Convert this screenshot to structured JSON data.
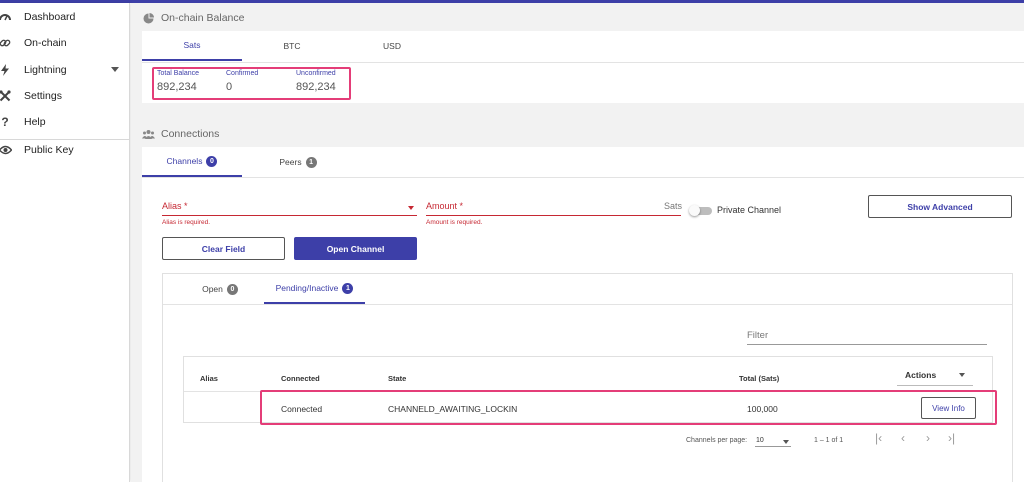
{
  "sidebar": {
    "items": [
      {
        "label": "Dashboard",
        "icon": "dashboard-icon"
      },
      {
        "label": "On-chain",
        "icon": "link-icon"
      },
      {
        "label": "Lightning",
        "icon": "lightning-icon"
      },
      {
        "label": "Settings",
        "icon": "settings-icon"
      },
      {
        "label": "Help",
        "icon": "help-icon"
      },
      {
        "label": "Public Key",
        "icon": "eye-icon"
      }
    ]
  },
  "balance": {
    "title": "On-chain Balance",
    "tabs": [
      "Sats",
      "BTC",
      "USD"
    ],
    "active_tab": "Sats",
    "total_label": "Total Balance",
    "total_value": "892,234",
    "confirmed_label": "Confirmed",
    "confirmed_value": "0",
    "unconfirmed_label": "Unconfirmed",
    "unconfirmed_value": "892,234"
  },
  "connections": {
    "title": "Connections",
    "tabs": [
      {
        "label": "Channels",
        "count": "0"
      },
      {
        "label": "Peers",
        "count": "1"
      }
    ],
    "form": {
      "alias_label": "Alias *",
      "alias_error": "Alias is required.",
      "amount_label": "Amount *",
      "amount_error": "Amount is required.",
      "amount_suffix": "Sats",
      "private_channel_label": "Private Channel",
      "show_advanced": "Show Advanced",
      "clear_field": "Clear Field",
      "open_channel": "Open Channel"
    },
    "channel_tabs": [
      {
        "label": "Open",
        "count": "0"
      },
      {
        "label": "Pending/Inactive",
        "count": "1"
      }
    ],
    "filter_placeholder": "Filter",
    "table": {
      "headers": {
        "alias": "Alias",
        "connected": "Connected",
        "state": "State",
        "total": "Total (Sats)",
        "actions": "Actions"
      },
      "rows": [
        {
          "alias": "",
          "connected": "Connected",
          "state": "CHANNELD_AWAITING_LOCKIN",
          "total": "100,000",
          "action": "View Info"
        }
      ]
    },
    "pagination": {
      "per_page_label": "Channels per page:",
      "per_page_value": "10",
      "range": "1 – 1 of 1"
    }
  },
  "colors": {
    "accent": "#3d3fa8",
    "error": "#c62833",
    "highlight": "#e43d78"
  }
}
